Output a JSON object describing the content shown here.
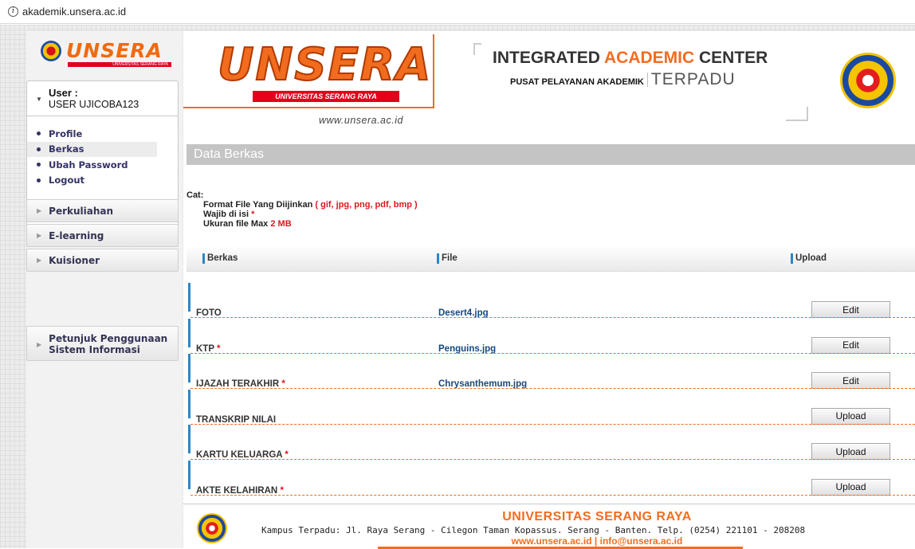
{
  "browser": {
    "url": "akademik.unsera.ac.id"
  },
  "sidebar": {
    "logo": {
      "word": "UNSERA",
      "sub": "UNIVERSITAS SERANG RAYA"
    },
    "user": {
      "label": "User :",
      "name": "USER UJICOBA123"
    },
    "menu": [
      {
        "label": "Profile"
      },
      {
        "label": "Berkas",
        "active": true
      },
      {
        "label": "Ubah Password"
      },
      {
        "label": "Logout"
      }
    ],
    "sections": [
      {
        "label": "Perkuliahan"
      },
      {
        "label": "E-learning"
      },
      {
        "label": "Kuisioner"
      }
    ],
    "help": {
      "line1": "Petunjuk Penggunaan",
      "line2": "Sistem Informasi"
    }
  },
  "header": {
    "logo_word": "UNSERA",
    "logo_sub": "UNIVERSITAS SERANG RAYA",
    "url": "www.unsera.ac.id",
    "title_pre": "INTEGRATED ",
    "title_accent": "ACADEMIC",
    "title_post": " CENTER",
    "pusat": "PUSAT PELAYANAN AKADEMIK",
    "terpadu": "TERPADU"
  },
  "page": {
    "title": "Data Berkas",
    "notes": {
      "cat": "Cat:",
      "format_label": "Format File Yang Diijinkan",
      "format_value": "( gif, jpg, png, pdf, bmp )",
      "wajib": "Wajib di isi",
      "star": "*",
      "max_label": "Ukuran file Max",
      "max_value": "2 MB"
    },
    "table": {
      "headers": {
        "berkas": "Berkas",
        "file": "File",
        "upload": "Upload"
      },
      "rows": [
        {
          "name": "FOTO",
          "required": "",
          "file": "Desert4.jpg",
          "action": "Edit"
        },
        {
          "name": "KTP",
          "required": "*",
          "file": "Penguins.jpg",
          "action": "Edit"
        },
        {
          "name": "IJAZAH TERAKHIR",
          "required": "*",
          "file": "Chrysanthemum.jpg",
          "action": "Edit"
        },
        {
          "name": "TRANSKRIP NILAI",
          "required": "",
          "file": "",
          "action": "Upload"
        },
        {
          "name": "KARTU KELUARGA",
          "required": "*",
          "file": "",
          "action": "Upload"
        },
        {
          "name": "AKTE KELAHIRAN",
          "required": "*",
          "file": "",
          "action": "Upload"
        }
      ]
    }
  },
  "footer": {
    "title": "UNIVERSITAS SERANG RAYA",
    "address": "Kampus Terpadu: Jl. Raya Serang - Cilegon Taman Kopassus. Serang - Banten. Telp. (0254) 221101 - 208208",
    "web": "www.unsera.ac.id | info@unsera.ac.id"
  },
  "colors": {
    "accent": "#f26c1f",
    "required": "#e0161e",
    "link": "#17487e",
    "column_marker": "#2a86c8"
  }
}
